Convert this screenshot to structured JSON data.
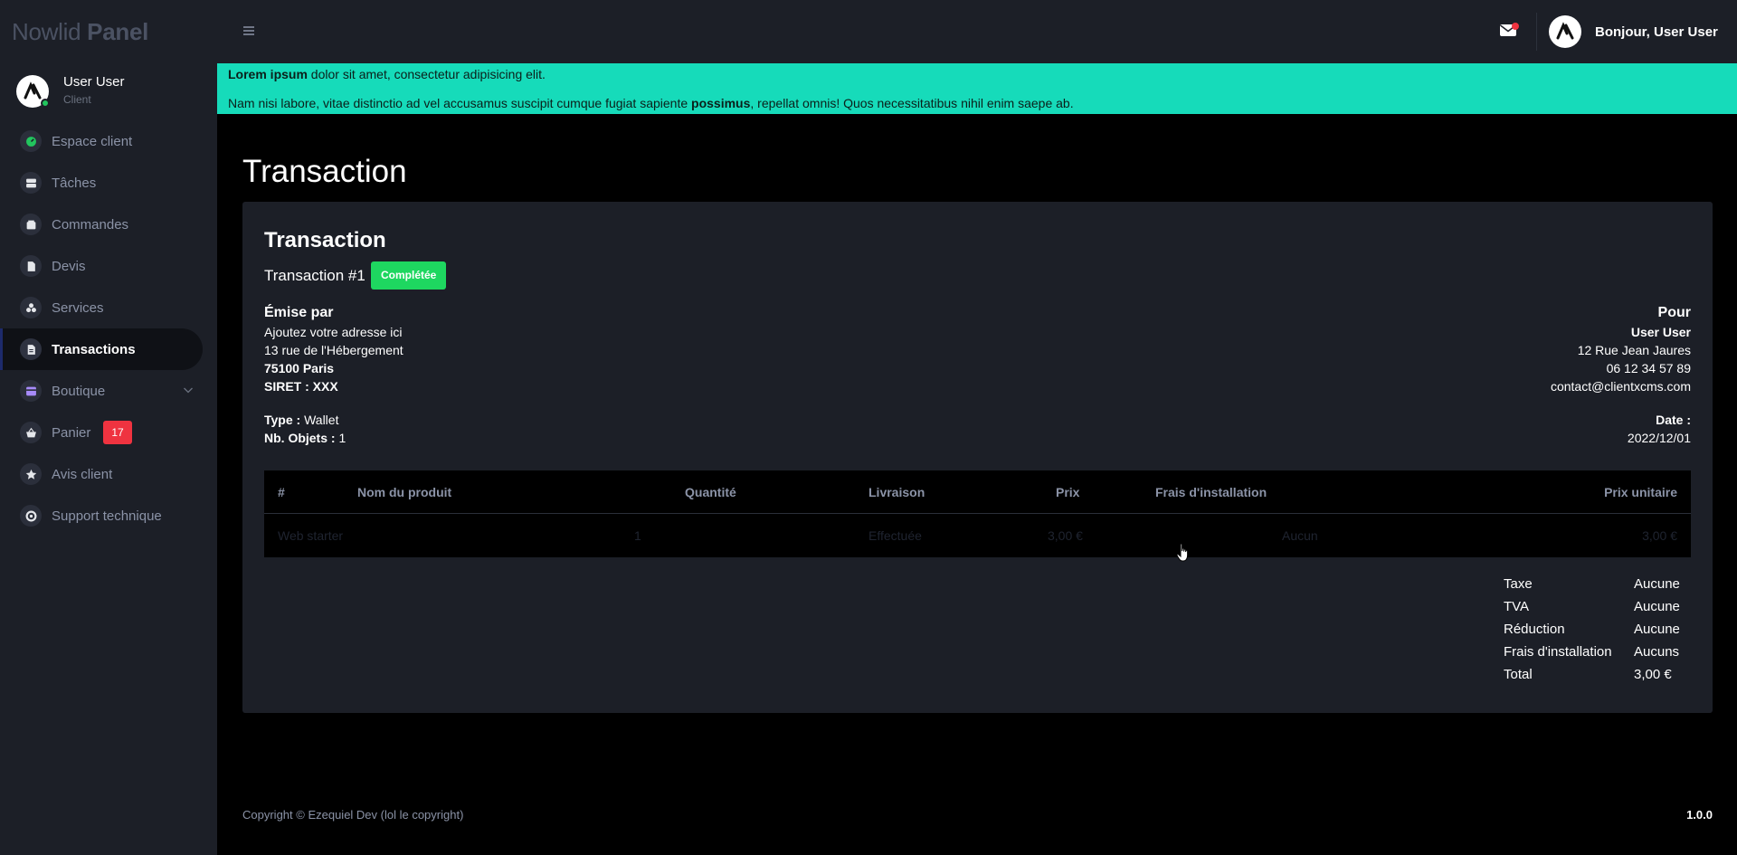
{
  "brand": {
    "light": "Nowlid ",
    "bold": "Panel"
  },
  "user": {
    "name": "User User",
    "role": "Client"
  },
  "nav": [
    {
      "label": "Espace client",
      "icon": "dashboard-icon"
    },
    {
      "label": "Tâches",
      "icon": "server-icon"
    },
    {
      "label": "Commandes",
      "icon": "box-icon"
    },
    {
      "label": "Devis",
      "icon": "file-icon"
    },
    {
      "label": "Services",
      "icon": "cubes-icon"
    },
    {
      "label": "Transactions",
      "icon": "invoice-icon",
      "active": true
    },
    {
      "label": "Boutique",
      "icon": "store-icon"
    },
    {
      "label": "Panier",
      "icon": "basket-icon",
      "badge": "17"
    },
    {
      "label": "Avis client",
      "icon": "star-icon"
    },
    {
      "label": "Support technique",
      "icon": "lifebuoy-icon"
    }
  ],
  "topbar": {
    "greeting": "Bonjour, User User"
  },
  "alert": {
    "line1_bold": "Lorem ipsum",
    "line1_rest": " dolor sit amet, consectetur adipisicing elit.",
    "line2_a": "Nam nisi labore, vitae distinctio ad vel accusamus suscipit cumque fugiat sapiente ",
    "line2_bold": "possimus",
    "line2_b": ", repellat omnis! Quos necessitatibus nihil enim saepe ab."
  },
  "page_title": "Transaction",
  "card": {
    "title": "Transaction",
    "number": "Transaction #1",
    "status": "Complétée",
    "from": {
      "heading": "Émise par",
      "line1": "Ajoutez votre adresse ici",
      "line2": "13 rue de l'Hébergement",
      "line3": "75100 Paris",
      "line4": "SIRET : XXX"
    },
    "to": {
      "heading": "Pour",
      "name": "User User",
      "address": "12 Rue Jean Jaures",
      "phone": "06 12 34 57 89",
      "email": "contact@clientxcms.com"
    },
    "meta": {
      "type_label": "Type :",
      "type_value": " Wallet",
      "objects_label": "Nb. Objets :",
      "objects_value": " 1",
      "date_label": "Date :",
      "date_value": "2022/12/01"
    },
    "table": {
      "headers": [
        "#",
        "Nom du produit",
        "Quantité",
        "Livraison",
        "Prix",
        "Frais d'installation",
        "Prix unitaire"
      ],
      "rows": [
        [
          "Web starter",
          "1",
          "Effectuée",
          "3,00 €",
          "Aucun",
          "3,00 €"
        ]
      ]
    },
    "totals": [
      {
        "label": "Taxe",
        "value": "Aucune"
      },
      {
        "label": "TVA",
        "value": "Aucune"
      },
      {
        "label": "Réduction",
        "value": "Aucune"
      },
      {
        "label": "Frais d'installation",
        "value": "Aucuns"
      },
      {
        "label": "Total",
        "value": "3,00 €"
      }
    ]
  },
  "footer": {
    "copyright": "Copyright © Ezequiel Dev (lol le copyright)",
    "version": "1.0.0"
  }
}
